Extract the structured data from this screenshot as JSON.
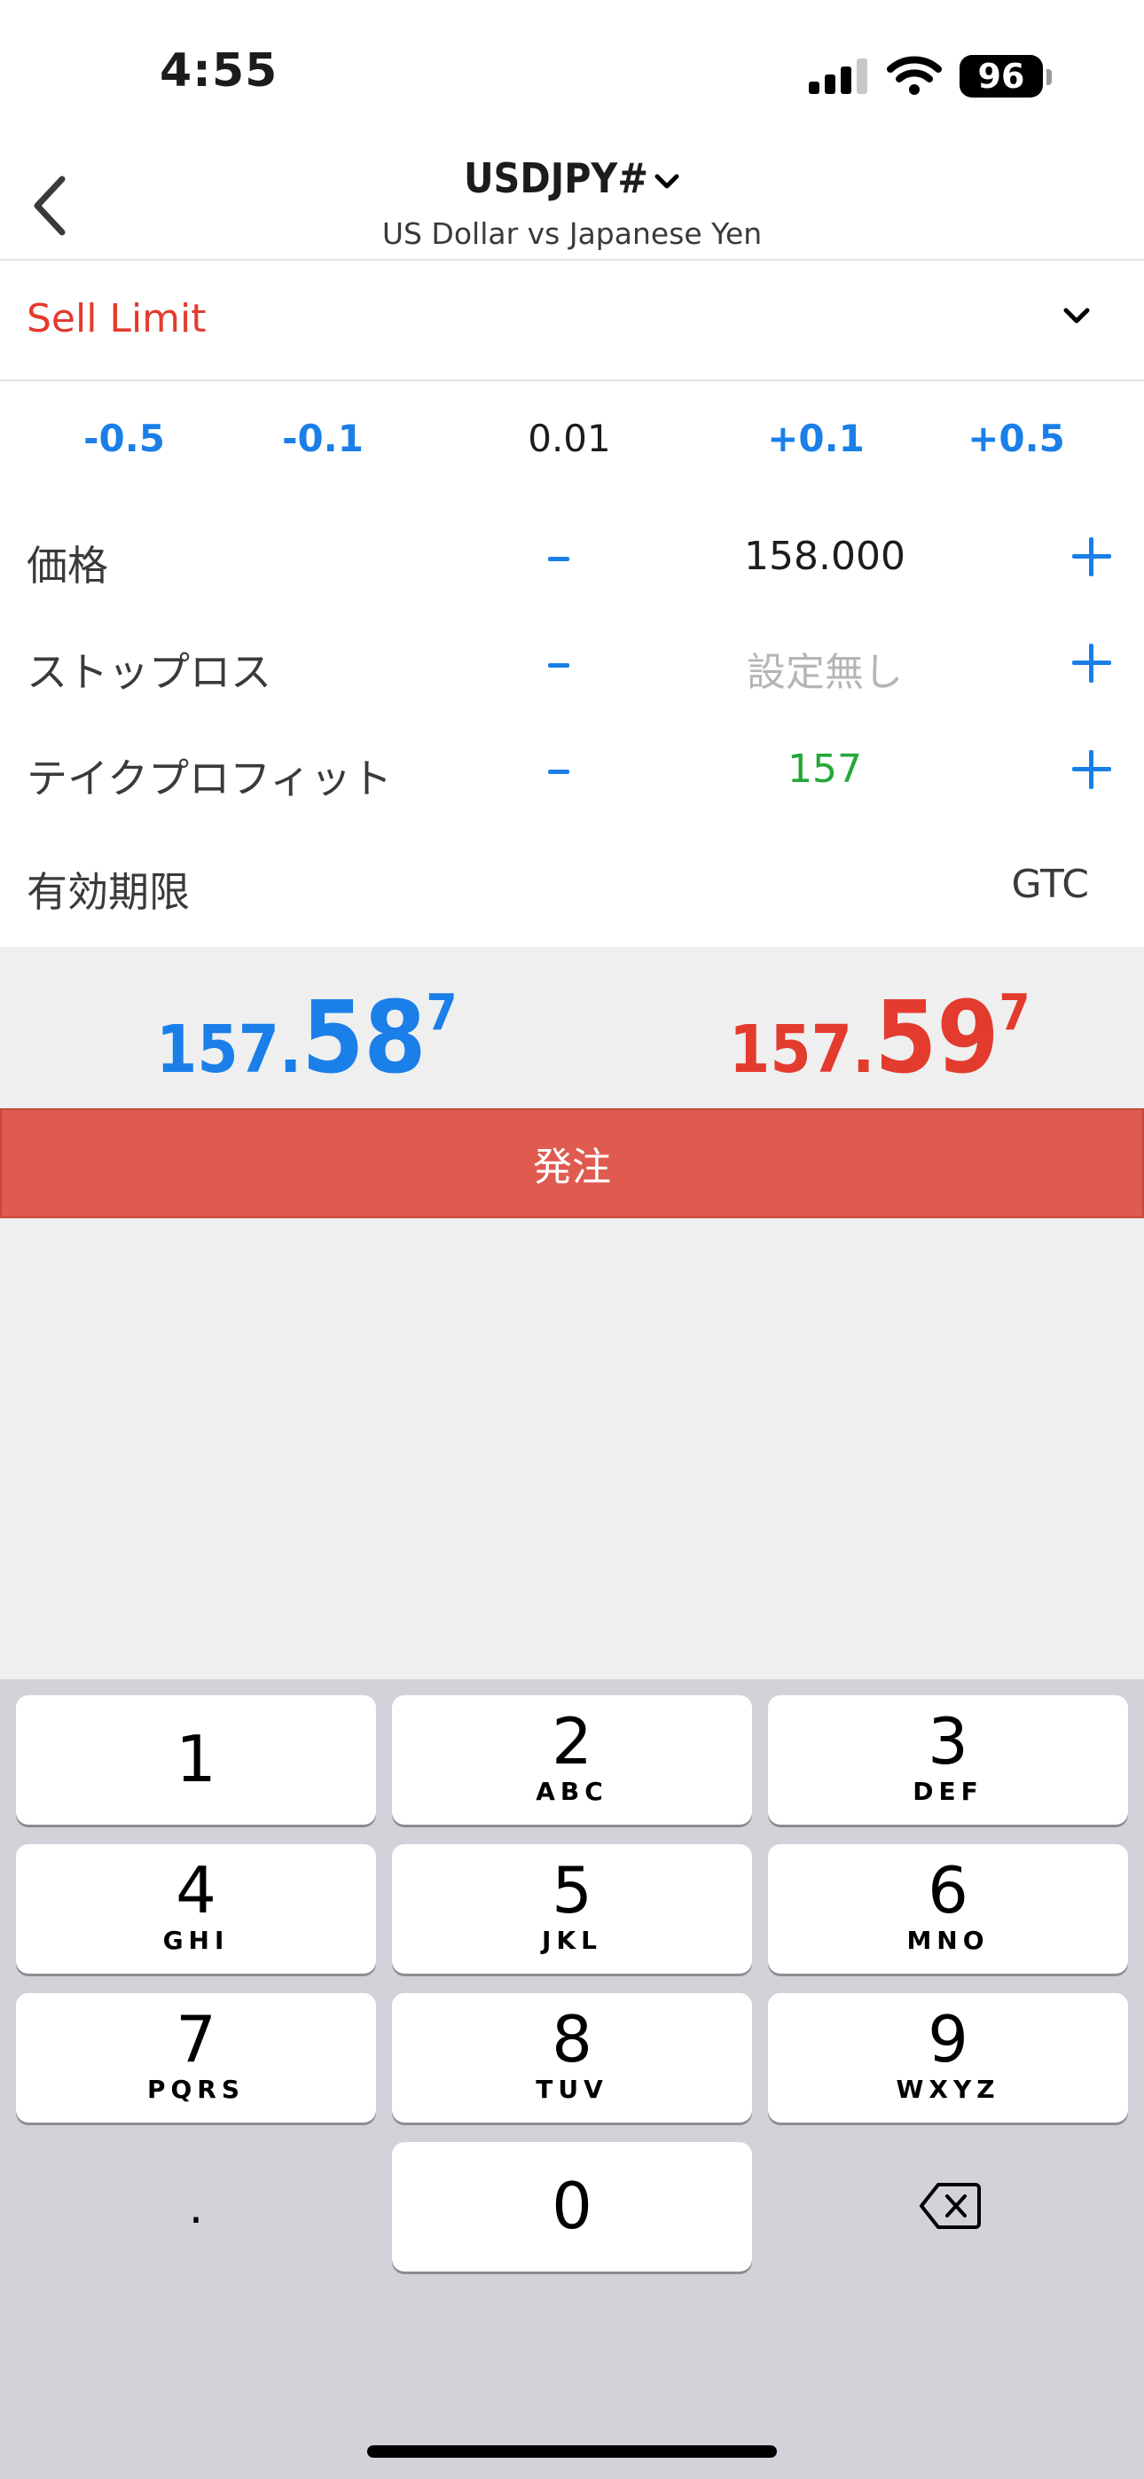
{
  "status": {
    "time": "4:55",
    "battery": "96"
  },
  "header": {
    "symbol": "USDJPY#",
    "subtitle": "US Dollar vs Japanese Yen"
  },
  "order_type": {
    "label": "Sell Limit"
  },
  "steps": [
    "-0.5",
    "-0.1",
    "0.01",
    "+0.1",
    "+0.5"
  ],
  "fields": {
    "price": {
      "label": "価格",
      "value": "158.000"
    },
    "stop_loss": {
      "label": "ストップロス",
      "value": "設定無し"
    },
    "take_profit": {
      "label": "テイクプロフィット",
      "value": "157"
    },
    "expiry": {
      "label": "有効期限",
      "value": "GTC"
    }
  },
  "quotes": {
    "bid": {
      "prefix": "157.",
      "big": "58",
      "sup": "7"
    },
    "ask": {
      "prefix": "157.",
      "big": "59",
      "sup": "7"
    }
  },
  "order_button": "発注",
  "keypad": {
    "keys": [
      {
        "num": "1",
        "letters": ""
      },
      {
        "num": "2",
        "letters": "ABC"
      },
      {
        "num": "3",
        "letters": "DEF"
      },
      {
        "num": "4",
        "letters": "GHI"
      },
      {
        "num": "5",
        "letters": "JKL"
      },
      {
        "num": "6",
        "letters": "MNO"
      },
      {
        "num": "7",
        "letters": "PQRS"
      },
      {
        "num": "8",
        "letters": "TUV"
      },
      {
        "num": "9",
        "letters": "WXYZ"
      },
      {
        "num": "0",
        "letters": ""
      }
    ],
    "dot": "."
  },
  "colors": {
    "accent_blue": "#1a7fe8",
    "sell_red": "#e33b2e",
    "order_button": "#df5a4f",
    "profit_green": "#22a838"
  }
}
